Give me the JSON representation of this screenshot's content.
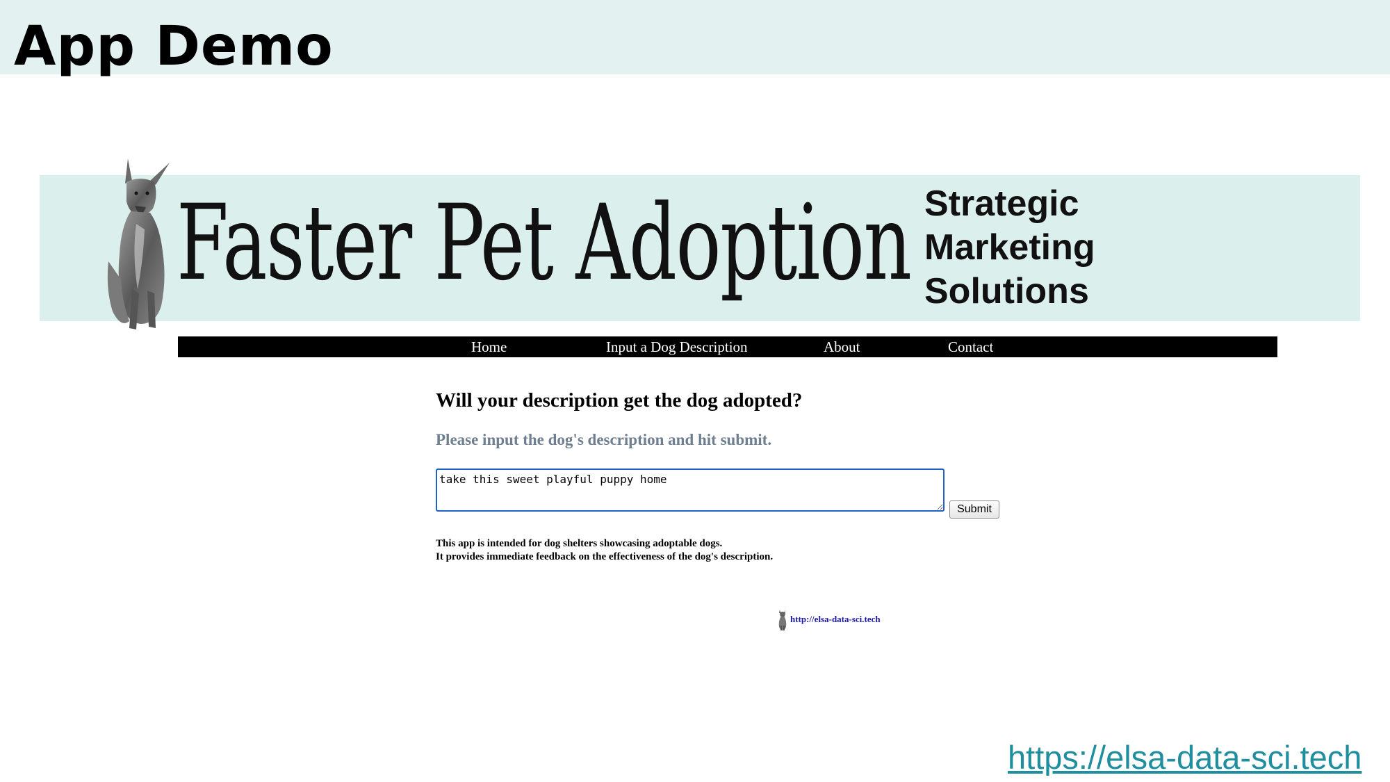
{
  "slide": {
    "title": "App Demo",
    "url": "https://elsa-data-sci.tech"
  },
  "banner": {
    "title": "Faster Pet Adoption",
    "tagline": [
      "Strategic",
      "Marketing",
      "Solutions"
    ],
    "logo_icon": "doberman-dog-icon"
  },
  "nav": {
    "items": [
      "Home",
      "Input a Dog Description",
      "About",
      "Contact"
    ]
  },
  "main": {
    "heading": "Will your description get the dog adopted?",
    "instruction": "Please input the dog's description and hit submit.",
    "textarea_value": "take this sweet playful puppy home",
    "submit_label": "Submit",
    "note_lines": [
      "This app is intended for dog shelters showcasing adoptable dogs.",
      "It provides immediate feedback on the effectiveness of the dog's description."
    ]
  },
  "footer": {
    "link_text": "http://elsa-data-sci.tech",
    "icon": "doberman-dog-icon"
  },
  "colors": {
    "header_bg": "#e3f2f1",
    "banner_bg": "#dbefed",
    "nav_bg": "#000000",
    "instruction_text": "#6f7f90",
    "textarea_focus_border": "#1f5fc8",
    "footer_link": "#1a1aa6",
    "slide_url": "#1f8e9f"
  }
}
